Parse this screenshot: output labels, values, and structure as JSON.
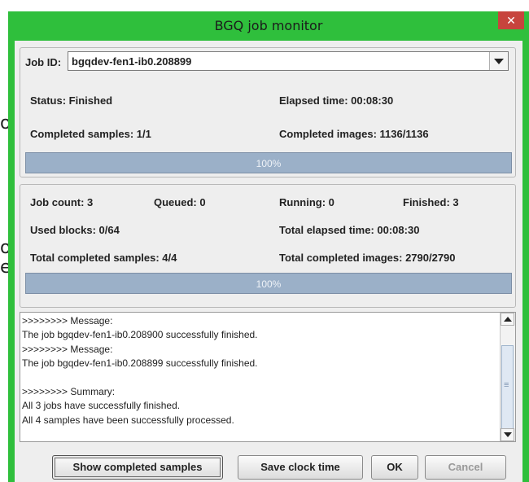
{
  "background": {
    "fragments": [
      "o",
      "o",
      "e"
    ]
  },
  "window": {
    "title": "BGQ job monitor",
    "close_symbol": "✕"
  },
  "job_panel": {
    "job_id_label": "Job ID:",
    "job_id_value": "bgqdev-fen1-ib0.208899",
    "status": "Status: Finished",
    "elapsed_time": "Elapsed time: 00:08:30",
    "completed_samples": "Completed samples: 1/1",
    "completed_images": "Completed images: 1136/1136",
    "progress": {
      "percent": 100,
      "label": "100%"
    }
  },
  "summary_panel": {
    "job_count": "Job count: 3",
    "queued": "Queued: 0",
    "running": "Running: 0",
    "finished": "Finished: 3",
    "used_blocks": "Used blocks: 0/64",
    "total_elapsed_time": "Total elapsed time: 00:08:30",
    "total_completed_samples": "Total completed samples: 4/4",
    "total_completed_images": "Total completed images: 2790/2790",
    "progress": {
      "percent": 100,
      "label": "100%"
    }
  },
  "log": {
    "lines": [
      ">>>>>>>> Message:",
      "The job bgqdev-fen1-ib0.208900 successfully finished.",
      ">>>>>>>> Message:",
      "The job bgqdev-fen1-ib0.208899 successfully finished.",
      "",
      ">>>>>>>> Summary:",
      "All 3 jobs have successfully finished.",
      "All 4 samples have been successfully processed."
    ]
  },
  "buttons": {
    "show_completed_samples": "Show completed samples",
    "save_clock_time": "Save clock time",
    "ok": "OK",
    "cancel": "Cancel"
  },
  "colors": {
    "window_frame": "#2fbf3c",
    "close_button": "#c7443d",
    "progress_fill": "#9bb0c8"
  }
}
